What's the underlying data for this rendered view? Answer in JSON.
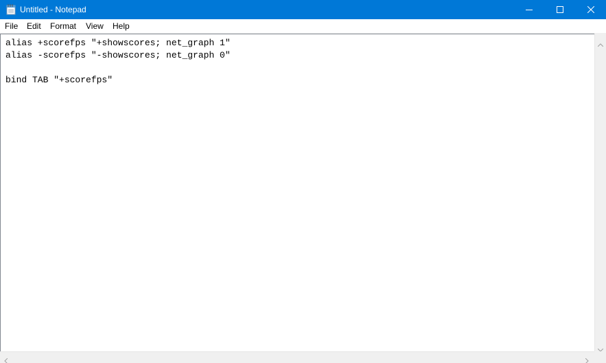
{
  "window": {
    "title": "Untitled - Notepad",
    "titlebar_color": "#0078d7",
    "app_icon": "notepad-icon",
    "controls": {
      "minimize_icon": "minimize-icon",
      "maximize_icon": "maximize-icon",
      "close_icon": "close-icon"
    }
  },
  "menubar": {
    "items": [
      "File",
      "Edit",
      "Format",
      "View",
      "Help"
    ]
  },
  "editor": {
    "lines": [
      "alias +scorefps \"+showscores; net_graph 1\"",
      "alias -scorefps \"-showscores; net_graph 0\"",
      "",
      "bind TAB \"+scorefps\""
    ]
  },
  "scrollbars": {
    "vertical": {
      "up_icon": "arrow-up-icon",
      "down_icon": "arrow-down-icon"
    },
    "horizontal": {
      "left_icon": "arrow-left-icon",
      "right_icon": "arrow-right-icon"
    }
  }
}
